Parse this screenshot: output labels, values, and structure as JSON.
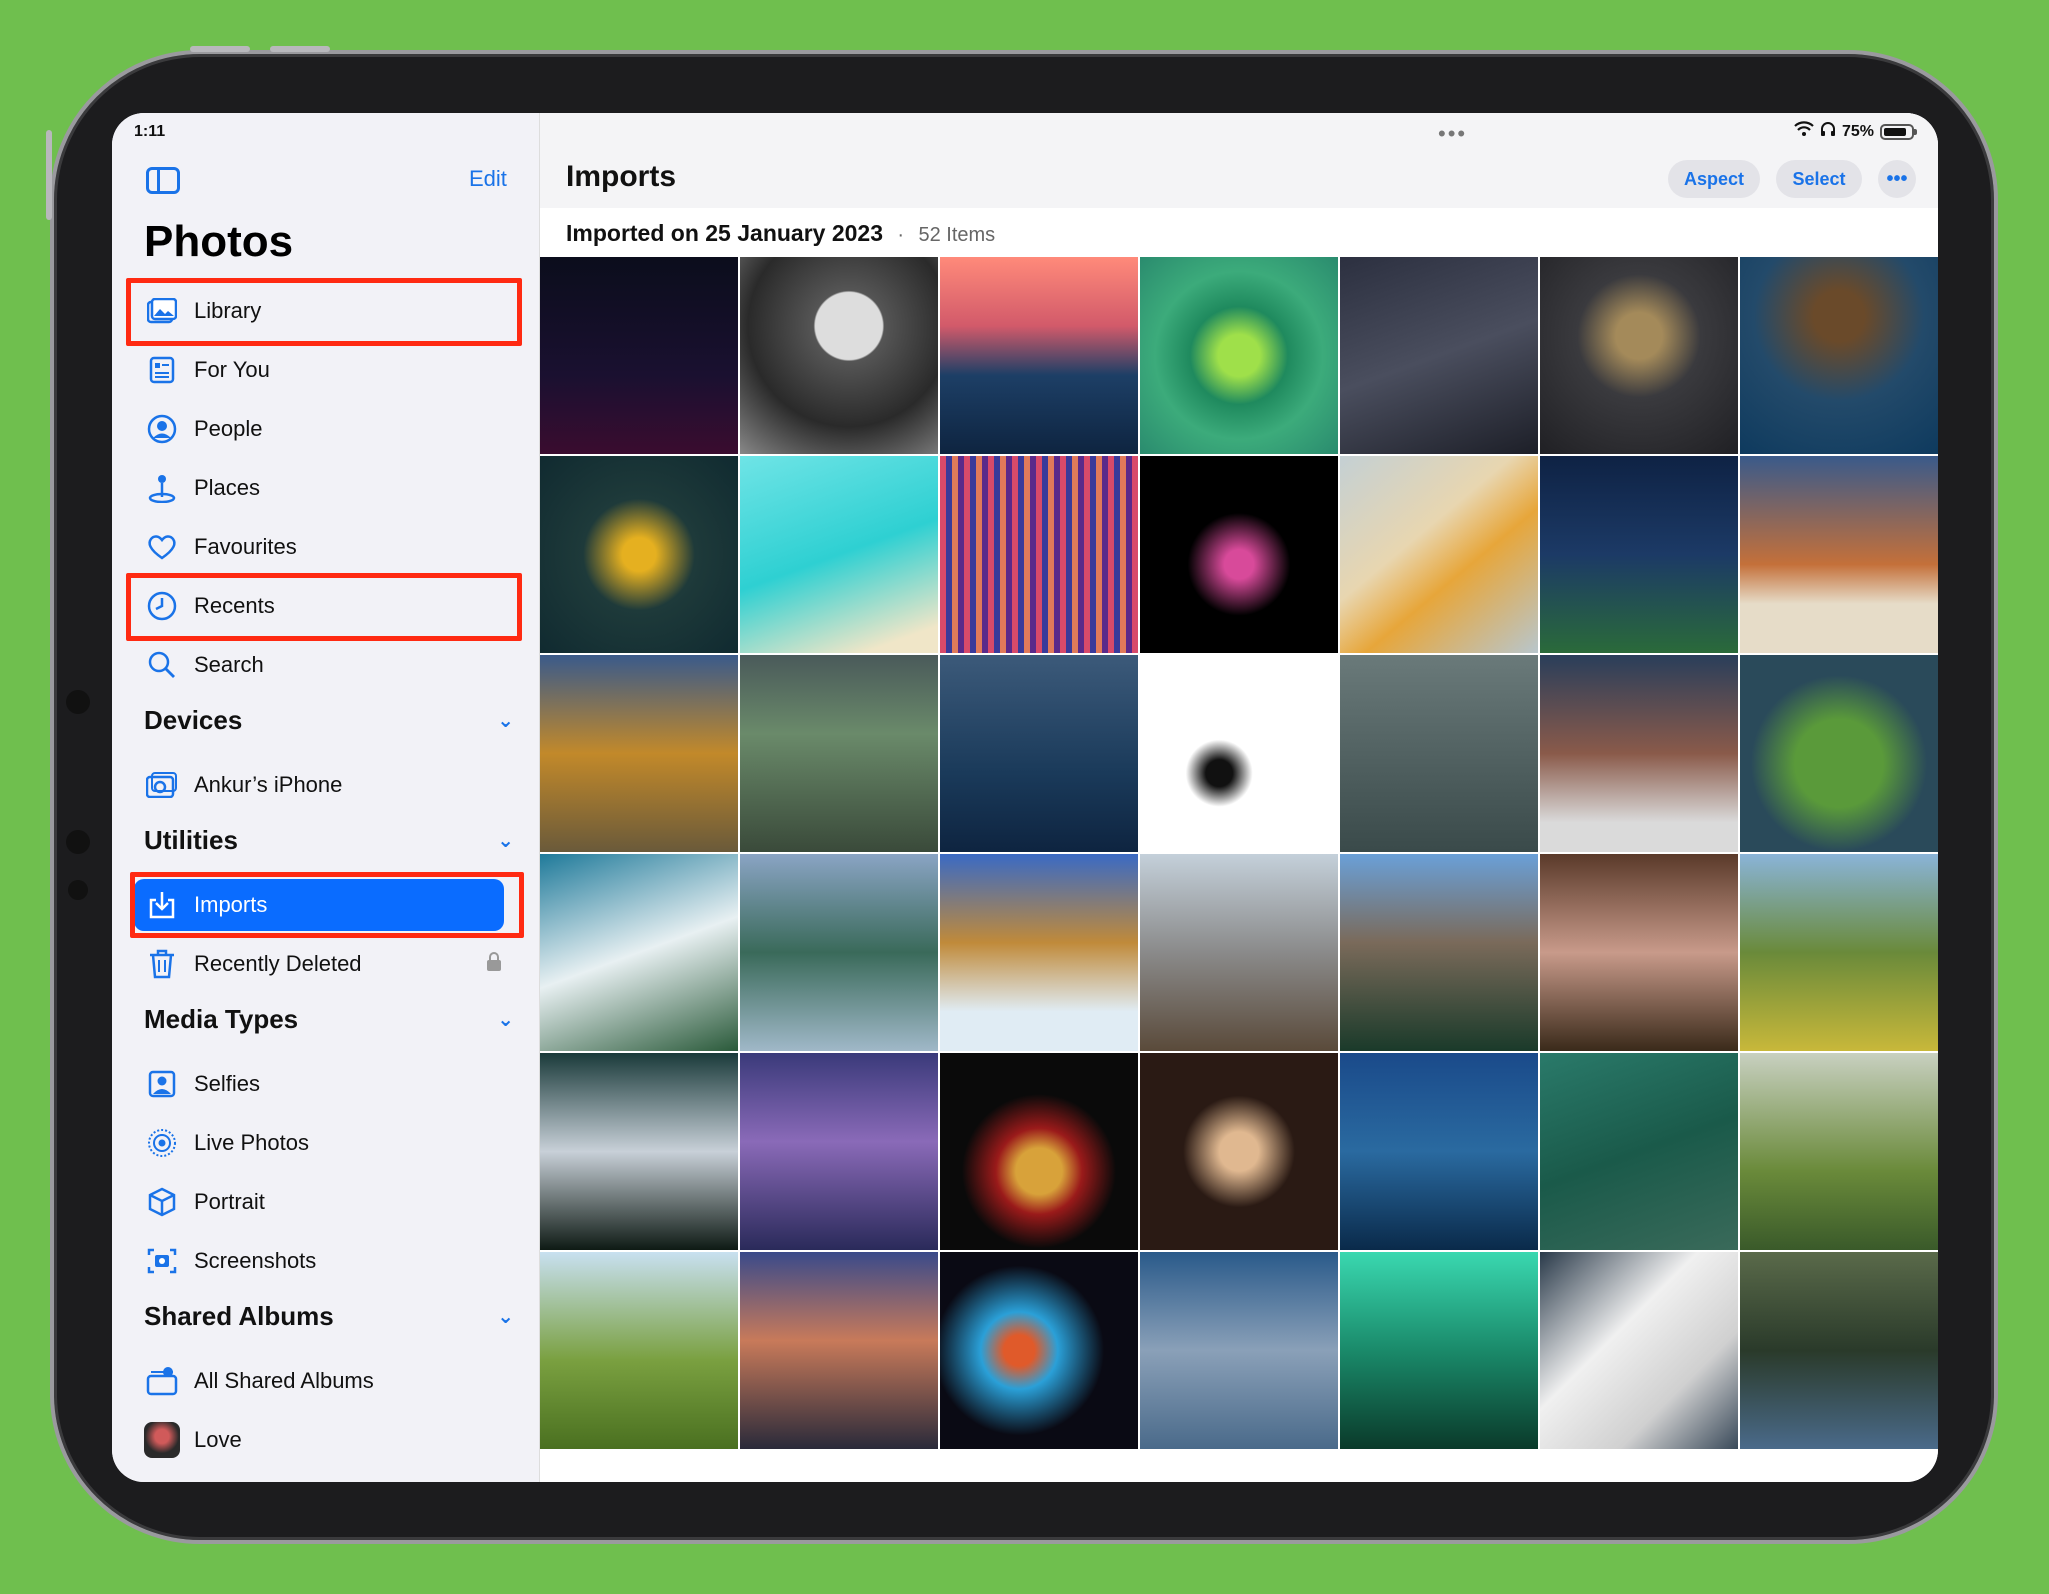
{
  "status": {
    "time": "1:11",
    "battery": "75%"
  },
  "sidebar": {
    "edit_label": "Edit",
    "title": "Photos",
    "items": [
      {
        "label": "Library",
        "icon": "library-icon"
      },
      {
        "label": "For You",
        "icon": "for-you-icon"
      },
      {
        "label": "People",
        "icon": "people-icon"
      },
      {
        "label": "Places",
        "icon": "places-icon"
      },
      {
        "label": "Favourites",
        "icon": "heart-icon"
      },
      {
        "label": "Recents",
        "icon": "clock-icon"
      },
      {
        "label": "Search",
        "icon": "search-icon"
      }
    ],
    "devices": {
      "title": "Devices",
      "items": [
        {
          "label": "Ankur’s iPhone",
          "icon": "iphone-import-icon"
        }
      ]
    },
    "utilities": {
      "title": "Utilities",
      "items": [
        {
          "label": "Imports",
          "icon": "import-icon"
        },
        {
          "label": "Recently Deleted",
          "icon": "trash-icon"
        }
      ]
    },
    "media_types": {
      "title": "Media Types",
      "items": [
        {
          "label": "Selfies",
          "icon": "selfie-icon"
        },
        {
          "label": "Live Photos",
          "icon": "live-photo-icon"
        },
        {
          "label": "Portrait",
          "icon": "cube-icon"
        },
        {
          "label": "Screenshots",
          "icon": "screenshot-icon"
        }
      ]
    },
    "shared_albums": {
      "title": "Shared Albums",
      "items": [
        {
          "label": "All Shared Albums",
          "icon": "shared-albums-icon"
        },
        {
          "label": "Love",
          "icon": "album-thumbnail"
        }
      ]
    }
  },
  "main": {
    "title": "Imports",
    "aspect_label": "Aspect",
    "select_label": "Select",
    "import_date": "Imported on 25 January 2023",
    "item_count": "52 Items"
  },
  "colors": {
    "accent": "#0a6cff",
    "highlight": "#ff2a12",
    "background": "#6fbf4e"
  },
  "photos": [
    "linear-gradient(180deg,#0b0d1c,#1a1030 60%,#3a0c2f)",
    "radial-gradient(circle at 55% 35%,#ddd 0 20%,#555 21%,#2a2a2a 60%,#888)",
    "linear-gradient(180deg,#ff8a7a,#d25a6a 35%,#1d3f66 60%,#0e2440)",
    "radial-gradient(circle,#9fe04a 0 15%,#1f8a5e 35%,#3cab7b 60%,#2a8b6e)",
    "linear-gradient(160deg,#2c3040,#4a4e5e 50%,#1d1f28)",
    "radial-gradient(circle at 50% 40%,#a48a5a 0 15%,#3a3a3e 40%,#202024)",
    "radial-gradient(circle at 50% 30%,#6a4a2a 0 15%,#234a6a 50%,#0e3a5e)",
    "radial-gradient(circle at 50% 50%,#e5b020 0 12%,#1e3a3a 40%,#102a30)",
    "linear-gradient(160deg,#6fe4e6,#2ed0d2 50%,#f0e6c8 90%)",
    "repeating-linear-gradient(90deg,#d84a6a 0 6px,#3a3a9a 6px 12px,#e07a5a 12px 18px,#5a2a8a 18px 24px)",
    "radial-gradient(circle at 50% 55%,#d84a9a 0 10%,#000 35%)",
    "linear-gradient(140deg,#c4d0d4,#e8d6b0 40%,#e7a63a 60%,#b8c6cc)",
    "linear-gradient(180deg,#0e2244,#1c3a66 50%,#2a6a3a)",
    "linear-gradient(180deg,#3a5a8a,#c4703a 55%,#e6dcc8 75%)",
    "linear-gradient(180deg,#3a5a8a,#c2892a 50%,#6a5a3a)",
    "linear-gradient(180deg,#4a5a5a,#6a8a6a 40%,#3a4a3a)",
    "linear-gradient(180deg,#3c5a7a,#1a3a5a 60%,#0e2440)",
    "radial-gradient(circle at 40% 60%,#111 0 8%,#fff 20%)",
    "linear-gradient(180deg,#6a7a7a,#3a4a4a)",
    "linear-gradient(180deg,#2a3e5a,#8a5a4a 50%,#dadada 85%)",
    "radial-gradient(circle at 50% 55%,#5a9a3a 0 30%,#2a4a5a 60%)",
    "linear-gradient(160deg,#1f7a9a,#e8f0f2 50%,#2a5a3a)",
    "linear-gradient(180deg,#8aa4c4,#3a6a5a 50%,#a0b8c8)",
    "linear-gradient(180deg,#3a6ac4,#c08a3a 45%,#e0ecf4 80%)",
    "linear-gradient(180deg,#c4d0da,#8a8a8a 50%,#5a4a3a)",
    "linear-gradient(180deg,#6aa0d8,#7a6a5a 45%,#1a3a2a)",
    "linear-gradient(180deg,#5a3a2a,#c89a8a 50%,#3a2a1a)",
    "linear-gradient(180deg,#8ab4d8,#6a8a3a 50%,#c8b83a)",
    "linear-gradient(180deg,#1a3a3a,#c8d0d8 50%,#0e1a14)",
    "linear-gradient(180deg,#3a3a7a,#8a6ab8 45%,#2a2a5a)",
    "radial-gradient(circle at 50% 60%,#d8a23a 0 15%,#9a1a1a 28%,#0a0a0a 50%)",
    "radial-gradient(circle at 50% 50%,#e0b890 0 14%,#2a1a14 40%)",
    "linear-gradient(180deg,#1a4a8a,#2a6aa0 50%,#0a2a4a)",
    "linear-gradient(160deg,#2a7a6a,#1a5a4a 50%,#3a6a5a)",
    "linear-gradient(180deg,#c8d0c0,#6a8a3a 60%,#3a5a2a)",
    "linear-gradient(180deg,#c8e0f0,#7aa040 55%,#4a7020)",
    "linear-gradient(180deg,#3a4a8a,#c87a5a 45%,#2a2a3a)",
    "radial-gradient(circle at 40% 50%,#e05a2a 0 10%,#2aa0d8 25%,#0a0a14 55%)",
    "linear-gradient(180deg,#2a5a8a,#8aa0b8 50%,#4a6a8a)",
    "linear-gradient(180deg,#3ad8b0,#1a8a6a 50%,#0a3a2a)",
    "linear-gradient(135deg,#2a3a4a,#f0f0f0 40%,#d0d0d0 70%,#3a4a5a)",
    "linear-gradient(180deg,#5a6a4a,#2a3a2a 50%,#4a6a8a)"
  ]
}
